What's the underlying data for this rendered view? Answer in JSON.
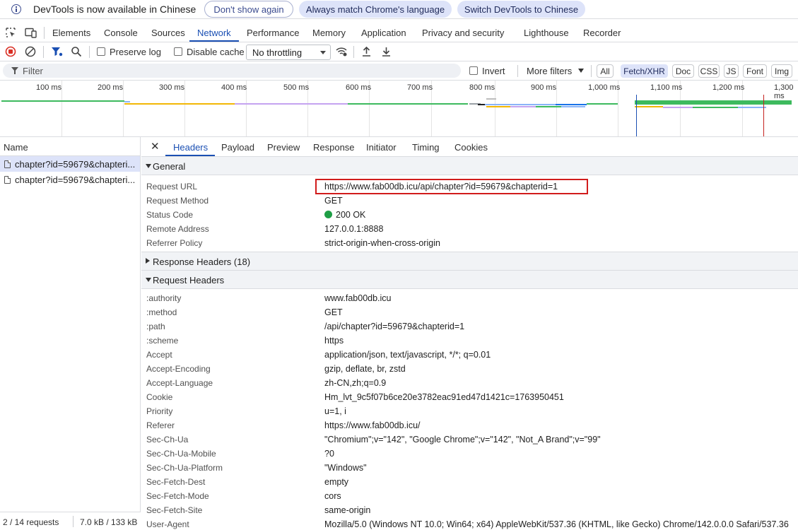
{
  "infobar": {
    "message": "DevTools is now available in Chinese",
    "dont_show": "Don't show again",
    "always_match": "Always match Chrome's language",
    "switch": "Switch DevTools to Chinese"
  },
  "main_tabs": [
    "Elements",
    "Console",
    "Sources",
    "Network",
    "Performance",
    "Memory",
    "Application",
    "Privacy and security",
    "Lighthouse",
    "Recorder"
  ],
  "active_main_tab": "Network",
  "toolbar": {
    "preserve_log": "Preserve log",
    "disable_cache": "Disable cache",
    "throttling": "No throttling"
  },
  "filterbar": {
    "placeholder": "Filter",
    "invert": "Invert",
    "more_filters": "More filters",
    "types": [
      "All",
      "Fetch/XHR",
      "Doc",
      "CSS",
      "JS",
      "Font",
      "Img"
    ],
    "active_type": "Fetch/XHR"
  },
  "timeline": {
    "ticks": [
      "100 ms",
      "200 ms",
      "300 ms",
      "400 ms",
      "500 ms",
      "600 ms",
      "700 ms",
      "800 ms",
      "900 ms",
      "1,000 ms",
      "1,100 ms",
      "1,200 ms",
      "1,300 ms"
    ]
  },
  "requests": {
    "header": "Name",
    "items": [
      "chapter?id=59679&chapteri...",
      "chapter?id=59679&chapteri..."
    ],
    "status": "2 / 14 requests",
    "size": "7.0 kB / 133 kB"
  },
  "detail": {
    "tabs": [
      "Headers",
      "Payload",
      "Preview",
      "Response",
      "Initiator",
      "Timing",
      "Cookies"
    ],
    "active_tab": "Headers",
    "general_title": "General",
    "general": [
      {
        "k": "Request URL",
        "v": "https://www.fab00db.icu/api/chapter?id=59679&chapterid=1"
      },
      {
        "k": "Request Method",
        "v": "GET"
      },
      {
        "k": "Status Code",
        "v": "200 OK"
      },
      {
        "k": "Remote Address",
        "v": "127.0.0.1:8888"
      },
      {
        "k": "Referrer Policy",
        "v": "strict-origin-when-cross-origin"
      }
    ],
    "response_headers_title": "Response Headers (18)",
    "request_headers_title": "Request Headers",
    "request_headers": [
      {
        "k": ":authority",
        "v": "www.fab00db.icu"
      },
      {
        "k": ":method",
        "v": "GET"
      },
      {
        "k": ":path",
        "v": "/api/chapter?id=59679&chapterid=1"
      },
      {
        "k": ":scheme",
        "v": "https"
      },
      {
        "k": "Accept",
        "v": "application/json, text/javascript, */*; q=0.01"
      },
      {
        "k": "Accept-Encoding",
        "v": "gzip, deflate, br, zstd"
      },
      {
        "k": "Accept-Language",
        "v": "zh-CN,zh;q=0.9"
      },
      {
        "k": "Cookie",
        "v": "Hm_lvt_9c5f07b6ce20e3782eac91ed47d1421c=1763950451"
      },
      {
        "k": "Priority",
        "v": "u=1, i"
      },
      {
        "k": "Referer",
        "v": "https://www.fab00db.icu/"
      },
      {
        "k": "Sec-Ch-Ua",
        "v": "\"Chromium\";v=\"142\", \"Google Chrome\";v=\"142\", \"Not_A Brand\";v=\"99\""
      },
      {
        "k": "Sec-Ch-Ua-Mobile",
        "v": "?0"
      },
      {
        "k": "Sec-Ch-Ua-Platform",
        "v": "\"Windows\""
      },
      {
        "k": "Sec-Fetch-Dest",
        "v": "empty"
      },
      {
        "k": "Sec-Fetch-Mode",
        "v": "cors"
      },
      {
        "k": "Sec-Fetch-Site",
        "v": "same-origin"
      },
      {
        "k": "User-Agent",
        "v": "Mozilla/5.0 (Windows NT 10.0; Win64; x64) AppleWebKit/537.36 (KHTML, like Gecko) Chrome/142.0.0.0 Safari/537.36"
      }
    ]
  },
  "colors": {
    "accent": "#1a4fb3",
    "selected_bg": "#dde3f9",
    "status_ok": "#1e9e45",
    "highlight_box": "#d11c1c",
    "record_red": "#d93025"
  }
}
